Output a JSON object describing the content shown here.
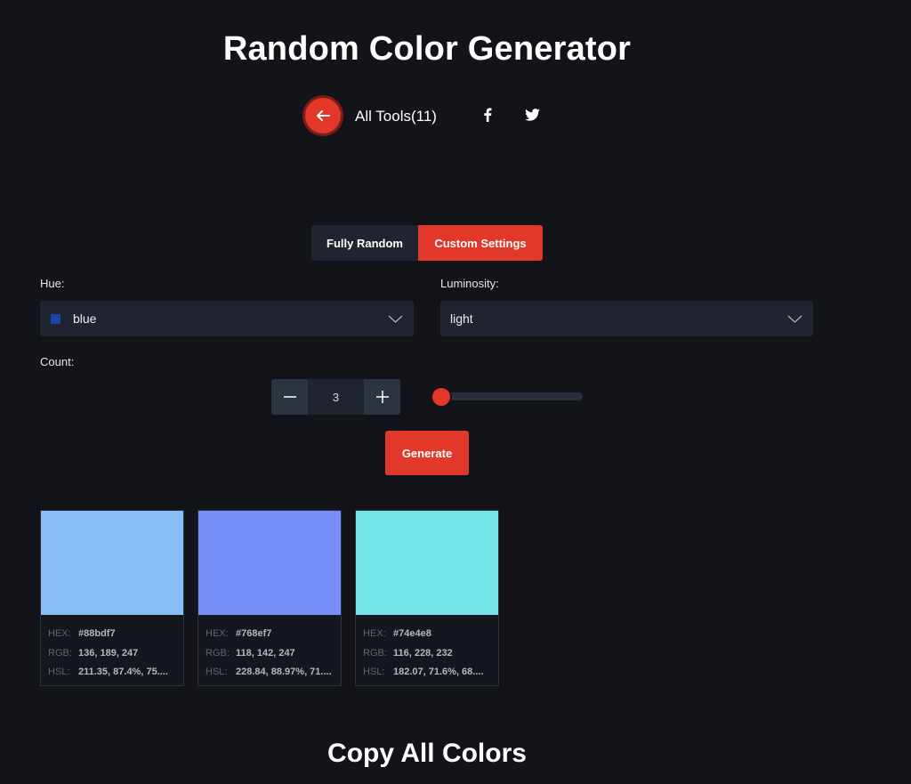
{
  "page": {
    "title": "Random Color Generator"
  },
  "nav": {
    "all_tools": "All Tools(11)",
    "back_icon": "arrow-left-icon",
    "facebook_icon": "facebook-icon",
    "twitter_icon": "twitter-icon"
  },
  "mode": {
    "tabs": [
      {
        "label": "Fully Random",
        "active": false
      },
      {
        "label": "Custom Settings",
        "active": true
      }
    ]
  },
  "hue": {
    "label": "Hue:",
    "value": "blue",
    "swatch_color": "#1745a8"
  },
  "luminosity": {
    "label": "Luminosity:",
    "value": "light"
  },
  "count": {
    "label": "Count:",
    "value": "3",
    "slider_fraction": 0.07
  },
  "generate": {
    "label": "Generate"
  },
  "colors": [
    {
      "hex_label": "HEX:",
      "hex": "#88bdf7",
      "rgb_label": "RGB:",
      "rgb": "136, 189, 247",
      "hsl_label": "HSL:",
      "hsl": "211.35, 87.4%, 75...."
    },
    {
      "hex_label": "HEX:",
      "hex": "#768ef7",
      "rgb_label": "RGB:",
      "rgb": "118, 142, 247",
      "hsl_label": "HSL:",
      "hsl": "228.84, 88.97%, 71...."
    },
    {
      "hex_label": "HEX:",
      "hex": "#74e4e8",
      "rgb_label": "RGB:",
      "rgb": "116, 228, 232",
      "hsl_label": "HSL:",
      "hsl": "182.07, 71.6%, 68...."
    }
  ],
  "copy_all": {
    "title": "Copy All Colors"
  },
  "theme": {
    "accent": "#e1382a",
    "background": "#121419",
    "panel": "#1f2430"
  }
}
